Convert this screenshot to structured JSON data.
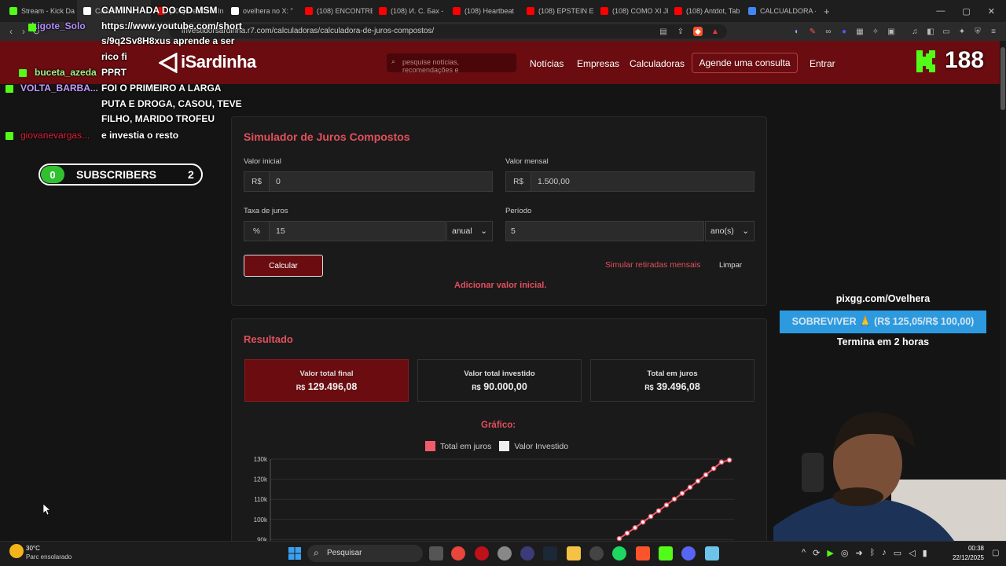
{
  "browser": {
    "tabs": [
      {
        "label": "Stream - Kick Da",
        "color": "#53fc18"
      },
      {
        "label": "Calculadora",
        "color": "#ffffff"
      },
      {
        "label": "(108) Decifre A In",
        "color": "#ff0000"
      },
      {
        "label": "ovelhera no X: \"",
        "color": "#ffffff"
      },
      {
        "label": "(108) ENCONTRE",
        "color": "#ff0000"
      },
      {
        "label": "(108) И. С. Бах -",
        "color": "#ff0000"
      },
      {
        "label": "(108) Heartbeat",
        "color": "#ff0000"
      },
      {
        "label": "(108) EPSTEIN ES",
        "color": "#ff0000"
      },
      {
        "label": "(108) COMO XI JI",
        "color": "#ff0000"
      },
      {
        "label": "(108) Antdot, Tab",
        "color": "#ff0000"
      },
      {
        "label": "CALCUALDORA -",
        "color": "#4285f4"
      }
    ],
    "new_tab": "+",
    "url": "investidorsardinha.r7.com/calculadoras/calculadora-de-juros-compostos/",
    "window_controls": [
      "—",
      "▢",
      "✕"
    ]
  },
  "site": {
    "logo": "iSardinha",
    "search_placeholder": "pesquise notícias, recomendações e",
    "nav": [
      "Notícias",
      "Empresas",
      "Calculadoras"
    ],
    "cta": "Agende uma consulta",
    "login": "Entrar"
  },
  "simulator": {
    "title": "Simulador de Juros Compostos",
    "initial_label": "Valor inicial",
    "initial_prefix": "R$",
    "initial_value": "0",
    "monthly_label": "Valor mensal",
    "monthly_prefix": "R$",
    "monthly_value": "1.500,00",
    "rate_label": "Taxa de juros",
    "rate_prefix": "%",
    "rate_value": "15",
    "rate_unit": "anual",
    "period_label": "Período",
    "period_value": "5",
    "period_unit": "ano(s)",
    "calc_button": "Calcular",
    "withdraw_link": "Simular retiradas mensais",
    "clear_link": "Limpar",
    "add_initial": "Adicionar valor inicial."
  },
  "result": {
    "title": "Resultado",
    "cards": [
      {
        "label": "Valor total final",
        "currency": "R$",
        "value": "129.496,08"
      },
      {
        "label": "Valor total investido",
        "currency": "R$",
        "value": "90.000,00"
      },
      {
        "label": "Total em juros",
        "currency": "R$",
        "value": "39.496,08"
      }
    ],
    "chart_title": "Gráfico:"
  },
  "chart_data": {
    "type": "line",
    "title": "Gráfico:",
    "legend": [
      "Total em juros",
      "Valor Investido"
    ],
    "legend_colors": [
      "#f25c6a",
      "#eeeeee"
    ],
    "y_ticks": [
      "130k",
      "120k",
      "110k",
      "100k",
      "90k"
    ],
    "ylim": [
      90000,
      130000
    ],
    "series": [
      {
        "name": "Total em juros",
        "color": "#f25c6a",
        "values": [
          90500,
          93200,
          95900,
          98700,
          101500,
          104300,
          107200,
          110100,
          113000,
          116000,
          119100,
          122200,
          125300,
          128500,
          129496
        ]
      }
    ]
  },
  "stream": {
    "chat": [
      {
        "user": "Ligote_Solo",
        "user_color": "#b58cff",
        "lines": [
          "CAMINHADA DO GD MSM",
          "https://www.youtube.com/short",
          "s/9q2Sv8H8xus aprende a ser",
          "rico fi"
        ]
      },
      {
        "user": "buceta_azeda",
        "user_color": "#9cf58a",
        "lines": [
          "PPRT"
        ]
      },
      {
        "user": "VOLTA_BARBA...",
        "user_color": "#c89cff",
        "lines": [
          "FOI O PRIMEIRO A LARGA",
          "PUTA E DROGA, CASOU, TEVE",
          "FILHO, MARIDO TROFEU"
        ]
      },
      {
        "user": "giovanevargas...",
        "user_color": "#e0203a",
        "lines": [
          "e investia o resto"
        ]
      }
    ],
    "subs_left": "0",
    "subs_label": "SUBSCRIBERS",
    "subs_right": "2",
    "viewers": "188",
    "pix_url": "pixgg.com/Ovelhera",
    "goal": "SOBREVIVER 🙏 (R$ 125,05/R$ 100,00)",
    "goal_ends": "Termina em 2 horas"
  },
  "taskbar": {
    "weather_temp": "30°C",
    "weather_desc": "Parc ensolarado",
    "search": "Pesquisar",
    "time": "00:38",
    "date": "22/12/2025"
  }
}
